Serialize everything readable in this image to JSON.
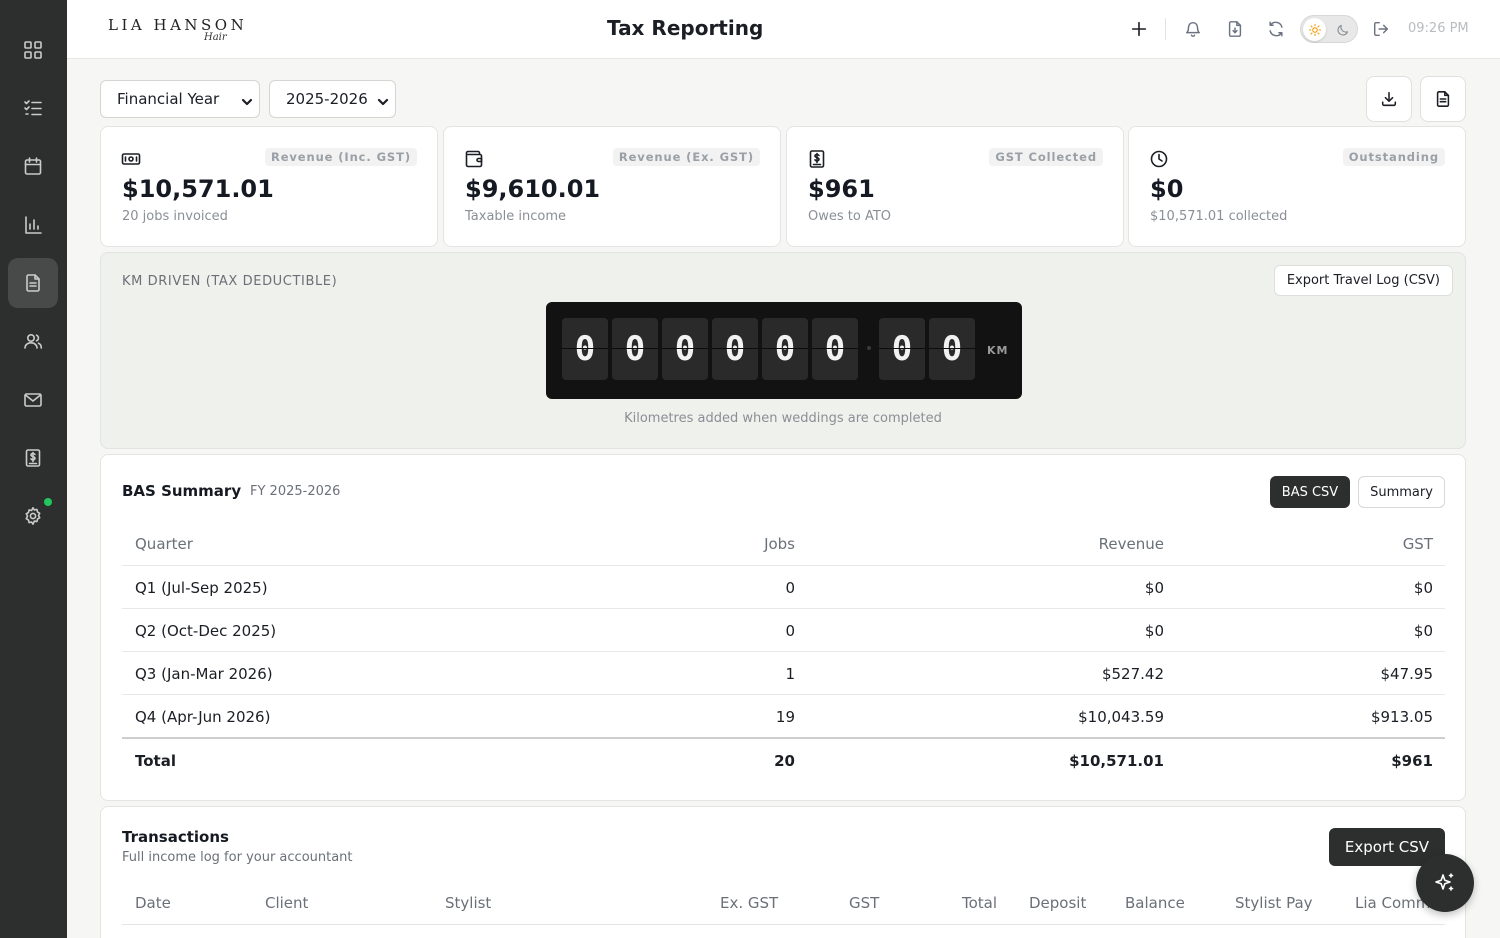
{
  "app": {
    "logo_text": "LIA HANSON",
    "logo_signature": "Hair",
    "page_title": "Tax Reporting",
    "time": "09:26 PM"
  },
  "sidebar": {
    "items": [
      {
        "icon": "grid-icon",
        "active": false
      },
      {
        "icon": "checklist-icon",
        "active": false
      },
      {
        "icon": "calendar-icon",
        "active": false
      },
      {
        "icon": "bar-chart-icon",
        "active": false
      },
      {
        "icon": "document-icon",
        "active": true
      },
      {
        "icon": "users-icon",
        "active": false
      },
      {
        "icon": "mail-icon",
        "active": false
      },
      {
        "icon": "invoice-icon",
        "active": false
      },
      {
        "icon": "gear-icon",
        "active": false
      }
    ],
    "status_dot_color": "#22c55e"
  },
  "filters": {
    "period_type": "Financial Year",
    "period": "2025-2026"
  },
  "stats": [
    {
      "icon": "cash-icon",
      "badge": "Revenue (Inc. GST)",
      "value": "$10,571.01",
      "sub": "20 jobs invoiced"
    },
    {
      "icon": "wallet-icon",
      "badge": "Revenue (Ex. GST)",
      "value": "$9,610.01",
      "sub": "Taxable income"
    },
    {
      "icon": "receipt-dollar-icon",
      "badge": "GST Collected",
      "value": "$961",
      "sub": "Owes to ATO"
    },
    {
      "icon": "clock-icon",
      "badge": "Outstanding",
      "value": "$0",
      "sub": "$10,571.01 collected"
    }
  ],
  "km": {
    "label": "KM DRIVEN (TAX DEDUCTIBLE)",
    "export_label": "Export Travel Log (CSV)",
    "digits": [
      "0",
      "0",
      "0",
      "0",
      "0",
      "0",
      "0",
      "0"
    ],
    "unit": "KM",
    "caption": "Kilometres added when weddings are completed"
  },
  "bas": {
    "title": "BAS Summary",
    "fy": "FY 2025-2026",
    "csv_label": "BAS CSV",
    "summary_label": "Summary",
    "headers": {
      "quarter": "Quarter",
      "jobs": "Jobs",
      "revenue": "Revenue",
      "gst": "GST"
    },
    "rows": [
      {
        "quarter": "Q1 (Jul-Sep 2025)",
        "jobs": "0",
        "revenue": "$0",
        "gst": "$0"
      },
      {
        "quarter": "Q2 (Oct-Dec 2025)",
        "jobs": "0",
        "revenue": "$0",
        "gst": "$0"
      },
      {
        "quarter": "Q3 (Jan-Mar 2026)",
        "jobs": "1",
        "revenue": "$527.42",
        "gst": "$47.95"
      },
      {
        "quarter": "Q4 (Apr-Jun 2026)",
        "jobs": "19",
        "revenue": "$10,043.59",
        "gst": "$913.05"
      }
    ],
    "total": {
      "quarter": "Total",
      "jobs": "20",
      "revenue": "$10,571.01",
      "gst": "$961"
    }
  },
  "transactions": {
    "title": "Transactions",
    "subtitle": "Full income log for your accountant",
    "export_label": "Export CSV",
    "columns": [
      "Date",
      "Client",
      "Stylist",
      "Ex. GST",
      "GST",
      "Total",
      "Deposit",
      "Balance",
      "Stylist Pay",
      "Lia Comm"
    ]
  }
}
